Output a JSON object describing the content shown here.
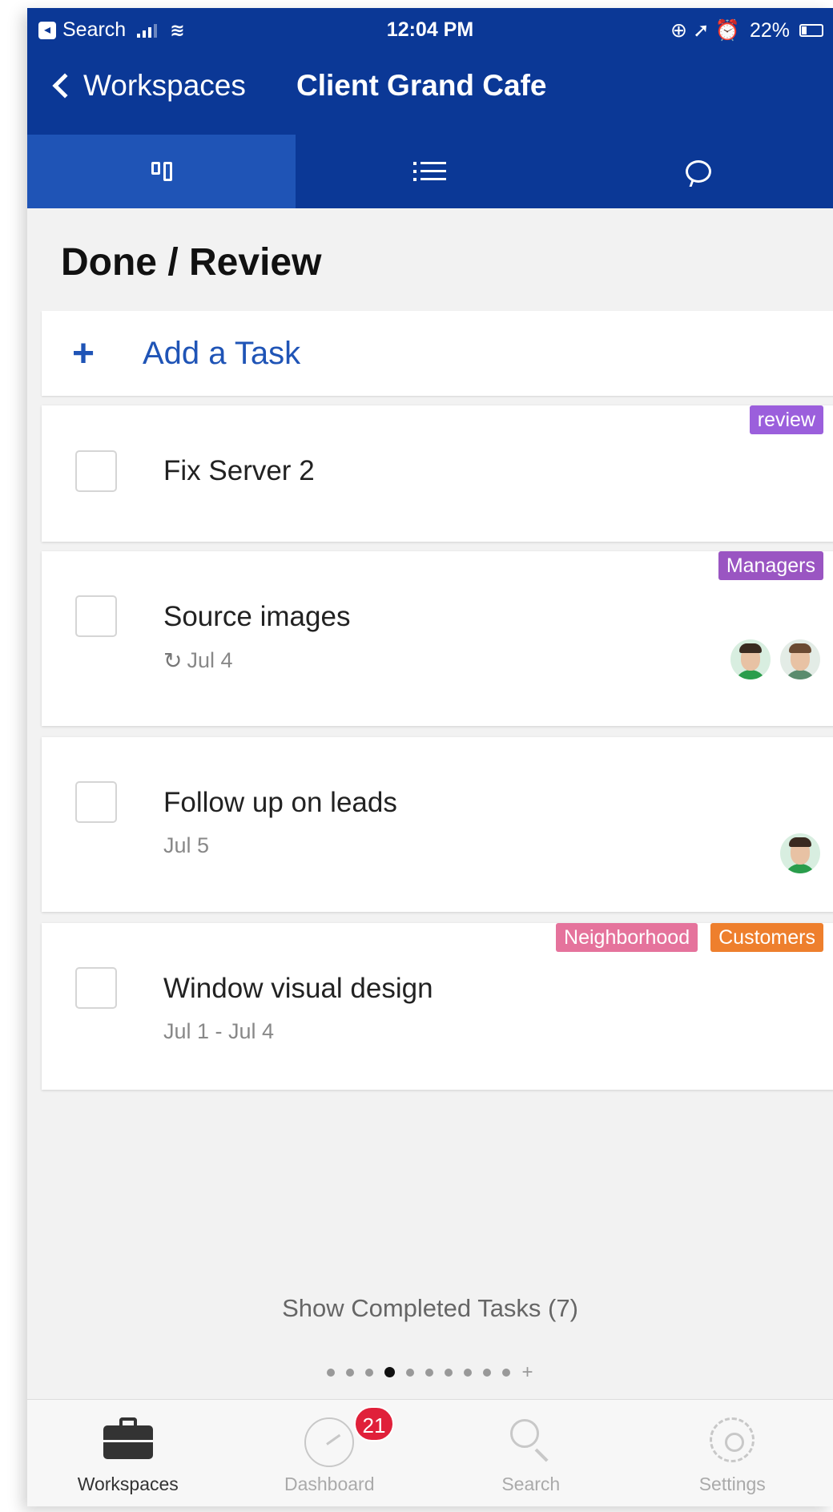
{
  "status_bar": {
    "carrier": "Search",
    "time": "12:04 PM",
    "battery": "22%",
    "indicators": "⊕ ➚ ⏰"
  },
  "nav": {
    "back_label": "Workspaces",
    "title": "Client Grand Cafe"
  },
  "view_tabs": [
    {
      "name": "board",
      "icon": "board-icon",
      "active": true
    },
    {
      "name": "list",
      "icon": "list-icon",
      "active": false
    },
    {
      "name": "chat",
      "icon": "chat-bubble-icon",
      "active": false
    }
  ],
  "section": {
    "title": "Done / Review"
  },
  "add_task": {
    "plus": "+",
    "label": "Add a Task"
  },
  "tasks": [
    {
      "title": "Fix Server 2",
      "date": "",
      "repeat": false,
      "tags": [
        {
          "label": "review",
          "color": "#9b5fdc"
        }
      ],
      "avatars": []
    },
    {
      "title": "Source images",
      "date": "Jul 4",
      "repeat": true,
      "tags": [
        {
          "label": "Managers",
          "color": "#9a55c2"
        }
      ],
      "avatars": [
        "#2a9d4c",
        "#5a8c6e"
      ]
    },
    {
      "title": "Follow up on leads",
      "date": "Jul 5",
      "repeat": false,
      "tags": [],
      "avatars": [
        "#2a9d4c"
      ]
    },
    {
      "title": "Window visual design",
      "date": "Jul 1 - Jul 4",
      "repeat": false,
      "tags": [
        {
          "label": "Neighborhood",
          "color": "#e5739c"
        },
        {
          "label": "Customers",
          "color": "#ee7f2d"
        }
      ],
      "avatars": []
    }
  ],
  "show_completed": "Show Completed Tasks (7)",
  "pager": {
    "total": 10,
    "active_index": 3,
    "add": "+"
  },
  "tabbar": {
    "items": [
      {
        "label": "Workspaces",
        "icon": "briefcase-icon",
        "active": true
      },
      {
        "label": "Dashboard",
        "icon": "dashboard-icon",
        "active": false,
        "badge": "21"
      },
      {
        "label": "Search",
        "icon": "search-icon",
        "active": false
      },
      {
        "label": "Settings",
        "icon": "gear-icon",
        "active": false
      }
    ]
  },
  "colors": {
    "header": "#0b3896",
    "active_tab": "#1f54b6",
    "accent": "#1f54b6",
    "badge": "#e0203a"
  }
}
